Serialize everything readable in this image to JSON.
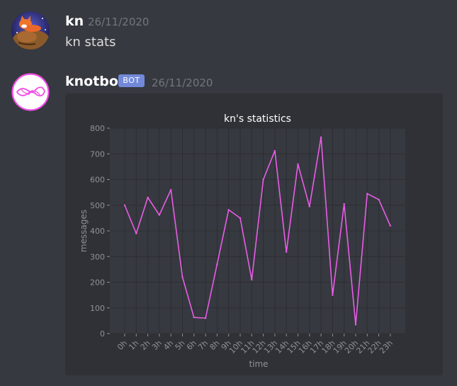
{
  "messages": [
    {
      "username": "kn",
      "timestamp": "26/11/2020",
      "text": "kn stats"
    },
    {
      "username": "knotbot",
      "badge": "BOT",
      "timestamp": "26/11/2020"
    }
  ],
  "colors": {
    "background": "#36393f",
    "embed": "#2f3136",
    "plot_bg": "#36393f",
    "line": "#ea5ce8",
    "bot_badge": "#7289da",
    "avatar_ring": "#f04ce4"
  },
  "chart_data": {
    "type": "line",
    "title": "kn's statistics",
    "xlabel": "time",
    "ylabel": "messages",
    "ylim": [
      0,
      800
    ],
    "yticks": [
      0,
      100,
      200,
      300,
      400,
      500,
      600,
      700,
      800
    ],
    "grid": true,
    "categories": [
      "0h",
      "1h",
      "2h",
      "3h",
      "4h",
      "5h",
      "6h",
      "7h",
      "8h",
      "9h",
      "10h",
      "11h",
      "12h",
      "13h",
      "14h",
      "15h",
      "16h",
      "17h",
      "18h",
      "19h",
      "20h",
      "21h",
      "22h",
      "23h"
    ],
    "values": [
      500,
      390,
      530,
      462,
      560,
      220,
      63,
      60,
      270,
      482,
      450,
      210,
      600,
      712,
      318,
      660,
      495,
      765,
      150,
      505,
      35,
      545,
      522,
      420
    ]
  }
}
